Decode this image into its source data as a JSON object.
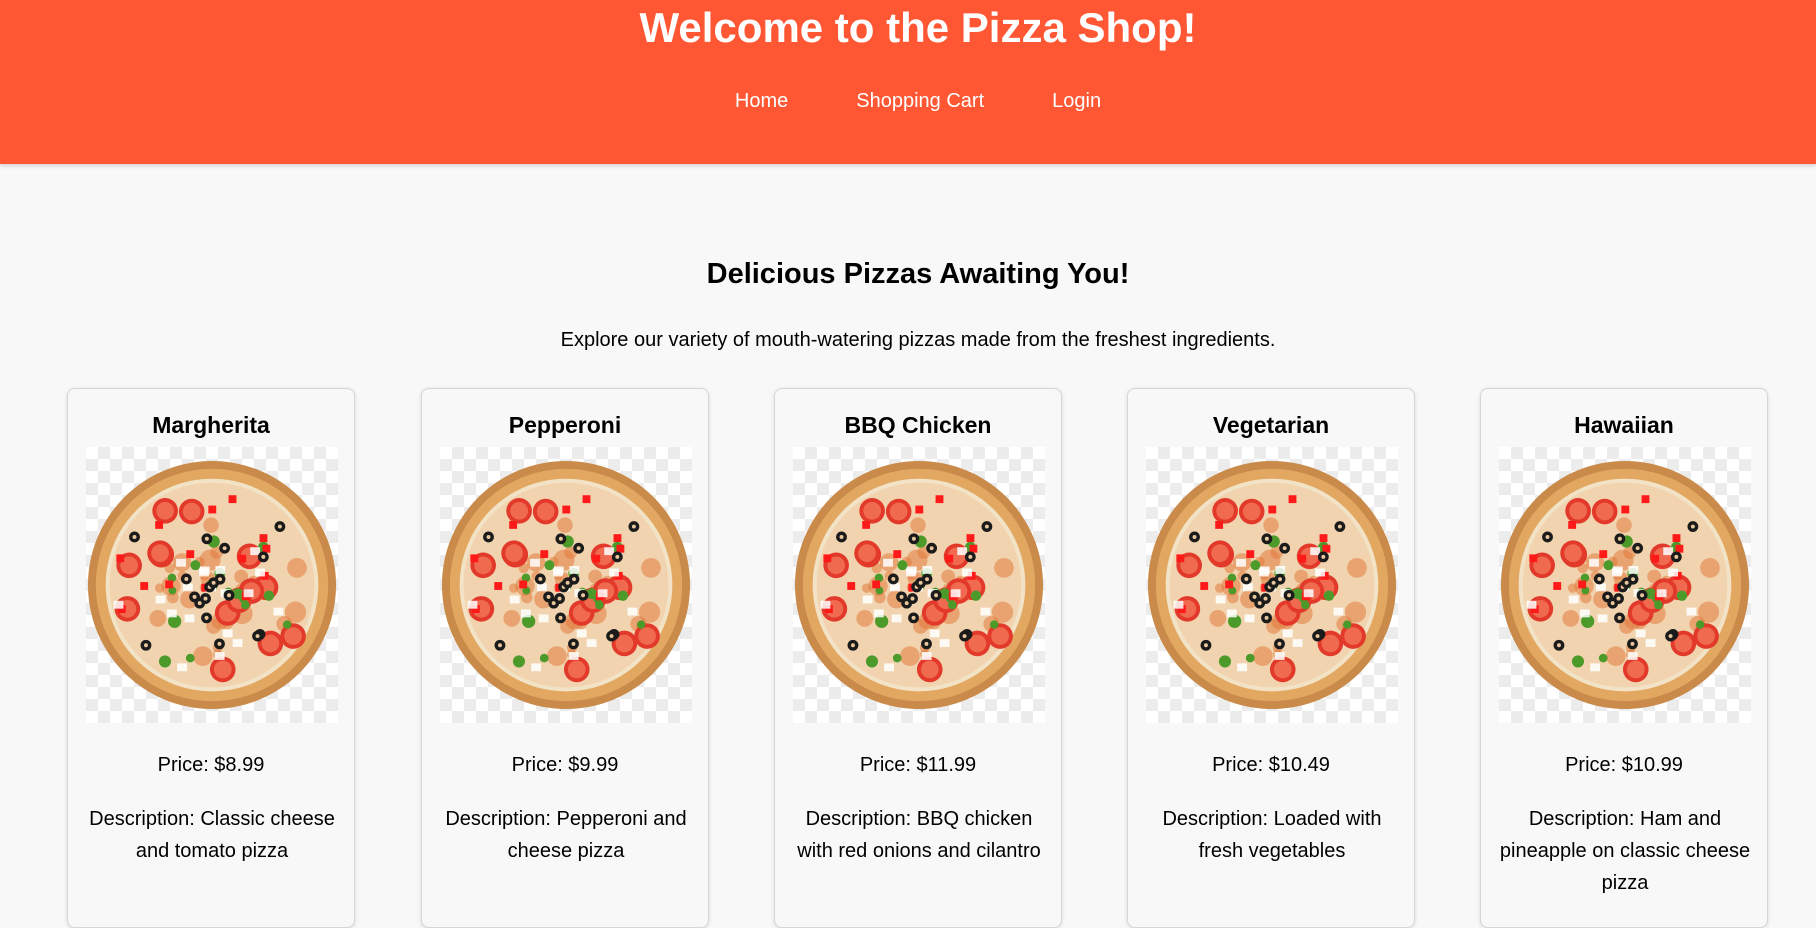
{
  "header": {
    "title": "Welcome to the Pizza Shop!",
    "nav": [
      "Home",
      "Shopping Cart",
      "Login"
    ],
    "background_color": "#ff5733"
  },
  "main": {
    "title": "Delicious Pizzas Awaiting You!",
    "subtitle": "Explore our variety of mouth-watering pizzas made from the freshest ingredients."
  },
  "pizzas": [
    {
      "name": "Margherita",
      "price": "Price: $8.99",
      "description": "Description: Classic cheese and tomato pizza",
      "image": "pizza-image"
    },
    {
      "name": "Pepperoni",
      "price": "Price: $9.99",
      "description": "Description: Pepperoni and cheese pizza",
      "image": "pizza-image"
    },
    {
      "name": "BBQ Chicken",
      "price": "Price: $11.99",
      "description": "Description: BBQ chicken with red onions and cilantro",
      "image": "pizza-image"
    },
    {
      "name": "Vegetarian",
      "price": "Price: $10.49",
      "description": "Description: Loaded with fresh vegetables",
      "image": "pizza-image"
    },
    {
      "name": "Hawaiian",
      "price": "Price: $10.99",
      "description": "Description: Ham and pineapple on classic cheese pizza",
      "image": "pizza-image"
    }
  ]
}
